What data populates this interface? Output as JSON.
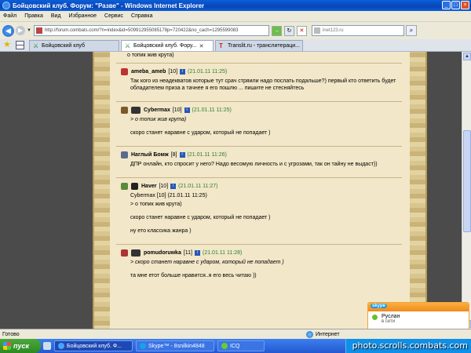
{
  "window": {
    "title": "Бойцовский клуб. Форум: \"Разве\" - Windows Internet Explorer",
    "controls": [
      "_",
      "□",
      "×"
    ]
  },
  "menu": [
    "Файл",
    "Правка",
    "Вид",
    "Избранное",
    "Сервис",
    "Справка"
  ],
  "address": {
    "url": "http://forum.combats.com/?n=index&id=509912955085178p=720422&no_cach=1295599083",
    "search_placeholder": "inet123.ru"
  },
  "tabs": [
    {
      "label": "Бойцовский клуб",
      "active": false
    },
    {
      "label": "Бойцовский клуб. Фору...",
      "active": true
    },
    {
      "label": "Translit.ru - транслитераци...",
      "active": false
    }
  ],
  "posts": {
    "top_line": "о топик жив крута)",
    "items": [
      {
        "user": "ameba_ameb",
        "level": "[10]",
        "date": "(21.01.11 11:25)",
        "lines": [
          {
            "text": "Так кого из неадекватов которые тут срач стряили надо послать подальше?) первый кто ответить будет обладателем приза а тачнее я его пошлю ... пишите не стесняйтесь",
            "quote": false
          }
        ]
      },
      {
        "user": "Cybermax",
        "level": "[10]",
        "date": "(21.01.11 11:25)",
        "lines": [
          {
            "text": "> о топик жив крута)",
            "quote": true
          },
          {
            "text": "скоро станет наравне с ударом, который не попадает )",
            "quote": false
          }
        ]
      },
      {
        "user": "Наглый Бомж",
        "level": "[8]",
        "date": "(21.01.11 11:26)",
        "lines": [
          {
            "text": "ДПР онлайн, кто спросит у него? Надо весомую личность и с угрозами, так он тайну не выдаст))",
            "quote": false
          }
        ]
      },
      {
        "user": "Haver",
        "level": "[10]",
        "date": "(21.01.11 11:27)",
        "lines": [
          {
            "text": "Cybermax [10] (21.01.11 11:25)",
            "quote": false
          },
          {
            "text": "> о топик жив крута)",
            "quote": false
          },
          {
            "text": "скоро станет наравне с ударом, который не попадает )",
            "quote": false
          },
          {
            "text": "ну ето классика жанра )",
            "quote": false
          }
        ]
      },
      {
        "user": "pomudoruwka",
        "level": "[11]",
        "date": "(21.01.11 11:28)",
        "lines": [
          {
            "text": "> скоро станет наравне с ударом, который не попадает )",
            "quote": true
          },
          {
            "text": "та мне етот больше нравится..я его весь читаю ))",
            "quote": false
          }
        ]
      }
    ]
  },
  "status": {
    "left": "Готово",
    "zone": "Интернет"
  },
  "taskbar": {
    "start": "пуск",
    "buttons": [
      {
        "label": "Бойцовский клуб. Ф...",
        "active": true
      },
      {
        "label": "Skype™ - 8snilkin4848",
        "active": false
      },
      {
        "label": "ICQ",
        "active": false
      }
    ],
    "watermark": "photo.scrolls.combats.com"
  },
  "skype_popup": {
    "logo": "skype",
    "name": "Руслан",
    "status": "в сети"
  },
  "colors": {
    "date_green": "#2e7d32",
    "parchment": "#f2e7c8",
    "background_dark": "#4b4b4b"
  }
}
